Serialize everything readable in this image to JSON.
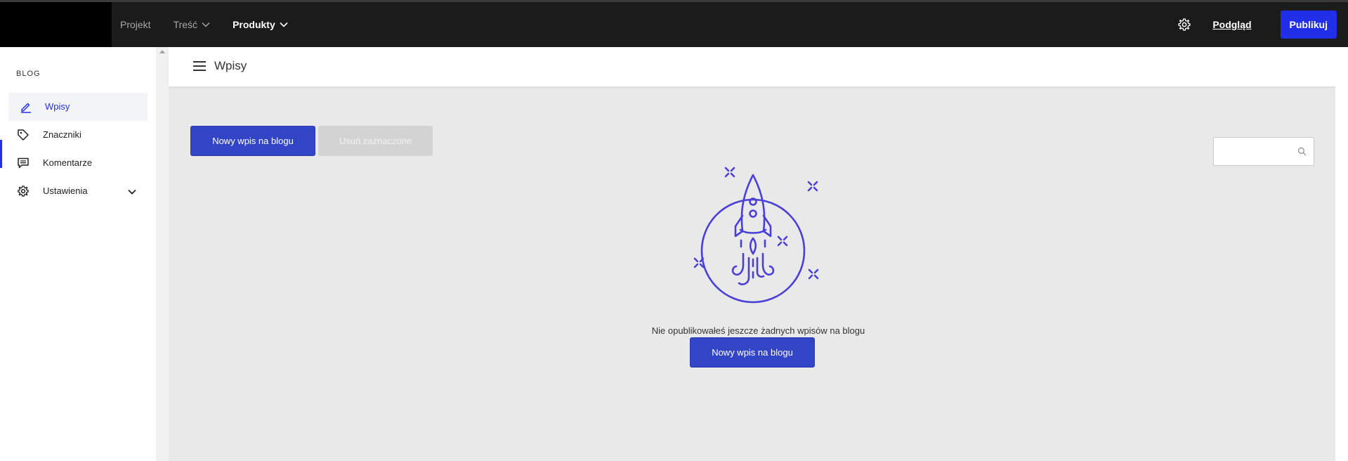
{
  "topbar": {
    "nav": [
      {
        "label": "Projekt",
        "has_dropdown": false,
        "active": false
      },
      {
        "label": "Treść",
        "has_dropdown": true,
        "active": false
      },
      {
        "label": "Produkty",
        "has_dropdown": true,
        "active": true
      }
    ],
    "preview_label": "Podgląd",
    "publish_label": "Publikuj",
    "settings_icon": "gear-icon"
  },
  "sidebar": {
    "heading": "BLOG",
    "items": [
      {
        "label": "Wpisy",
        "icon": "pencil-icon",
        "active": true
      },
      {
        "label": "Znaczniki",
        "icon": "tag-icon",
        "active": false
      },
      {
        "label": "Komentarze",
        "icon": "comment-icon",
        "active": false
      },
      {
        "label": "Ustawienia",
        "icon": "gear-icon",
        "active": false,
        "expandable": true
      }
    ]
  },
  "main": {
    "title": "Wpisy",
    "new_post_label": "Nowy wpis na blogu",
    "delete_selected_label": "Usuń zaznaczone",
    "search": {
      "value": "",
      "placeholder": ""
    },
    "empty_state": {
      "message": "Nie opublikowałeś jeszcze żadnych wpisów na blogu",
      "button_label": "Nowy wpis na blogu",
      "illustration": "rocket-illustration"
    }
  },
  "colors": {
    "accent": "#2130e8",
    "primary_button": "#3345c7",
    "illustration": "#4a3fd6",
    "topbar": "#1b1b1b",
    "main_bg": "#e9e9e9"
  }
}
